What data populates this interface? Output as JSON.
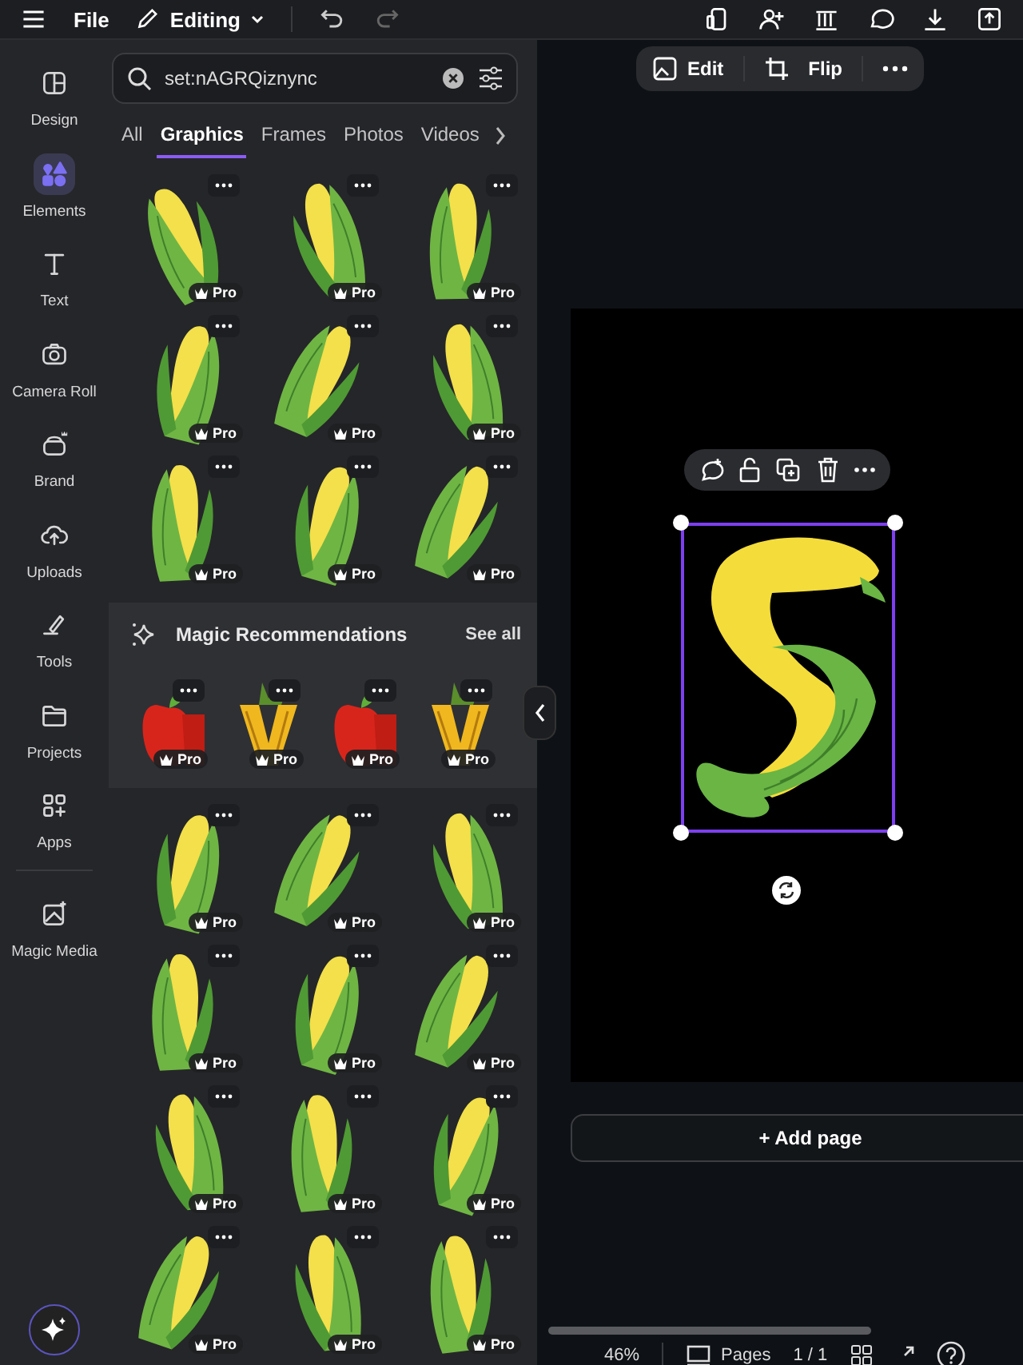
{
  "top_bar": {
    "menu": "File",
    "mode": "Editing"
  },
  "sidebar": {
    "items": [
      {
        "label": "Design",
        "selected": false
      },
      {
        "label": "Elements",
        "selected": true
      },
      {
        "label": "Text",
        "selected": false
      },
      {
        "label": "Camera Roll",
        "selected": false
      },
      {
        "label": "Brand",
        "selected": false
      },
      {
        "label": "Uploads",
        "selected": false
      },
      {
        "label": "Tools",
        "selected": false
      },
      {
        "label": "Projects",
        "selected": false
      },
      {
        "label": "Apps",
        "selected": false
      }
    ],
    "magic_media": "Magic Media"
  },
  "search": {
    "value": "set:nAGRQiznync"
  },
  "tabs": [
    {
      "label": "All",
      "selected": false
    },
    {
      "label": "Graphics",
      "selected": true
    },
    {
      "label": "Frames",
      "selected": false
    },
    {
      "label": "Photos",
      "selected": false
    },
    {
      "label": "Videos",
      "selected": false
    }
  ],
  "graphics_top": [
    {
      "badge": "Pro"
    },
    {
      "badge": "Pro"
    },
    {
      "badge": "Pro"
    },
    {
      "badge": "Pro"
    },
    {
      "badge": "Pro"
    },
    {
      "badge": "Pro"
    },
    {
      "badge": "Pro"
    },
    {
      "badge": "Pro"
    },
    {
      "badge": "Pro"
    }
  ],
  "magic_recommendations": {
    "title": "Magic Recommendations",
    "link": "See all",
    "items": [
      {
        "kind": "apple",
        "badge": "Pro"
      },
      {
        "kind": "pineapple",
        "badge": "Pro"
      },
      {
        "kind": "apple",
        "badge": "Pro"
      },
      {
        "kind": "pineapple",
        "badge": "Pro"
      }
    ]
  },
  "graphics_bottom": [
    {
      "badge": "Pro"
    },
    {
      "badge": "Pro"
    },
    {
      "badge": "Pro"
    },
    {
      "badge": "Pro"
    },
    {
      "badge": "Pro"
    },
    {
      "badge": "Pro"
    },
    {
      "badge": "Pro"
    },
    {
      "badge": "Pro"
    },
    {
      "badge": "Pro"
    },
    {
      "badge": "Pro"
    },
    {
      "badge": "Pro"
    },
    {
      "badge": "Pro"
    }
  ],
  "canvas": {
    "edit": "Edit",
    "flip": "Flip",
    "add_page": "+ Add page"
  },
  "footer": {
    "zoom": "46%",
    "pages": "Pages",
    "page_count": "1 / 1"
  }
}
